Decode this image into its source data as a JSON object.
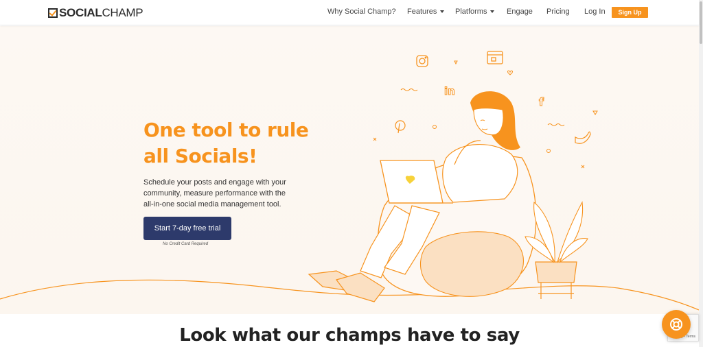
{
  "brand": {
    "logo_bold": "SOCIAL",
    "logo_light": "CHAMP"
  },
  "nav": {
    "why": "Why Social Champ?",
    "features": "Features",
    "platforms": "Platforms",
    "engage": "Engage",
    "pricing": "Pricing",
    "login": "Log In",
    "signup": "Sign Up"
  },
  "hero": {
    "title_line1": "One tool to rule",
    "title_line2": "all Socials!",
    "subtitle": "Schedule your posts and engage with your community, measure performance with the all-in-one social media management tool.",
    "cta": "Start 7-day free trial",
    "cta_note": "No Credit Card Required"
  },
  "section": {
    "title": "Look what our champs have to say"
  },
  "recaptcha": {
    "text": "Privacy - Terms"
  },
  "colors": {
    "brand_orange": "#f7931e",
    "cta_navy": "#2d3a6b",
    "hero_bg": "#fdf8f3"
  },
  "icons": [
    "instagram-icon",
    "linkedin-icon",
    "facebook-icon",
    "twitter-icon",
    "pinterest-icon",
    "store-icon",
    "heart-icon",
    "chat-support-icon"
  ]
}
